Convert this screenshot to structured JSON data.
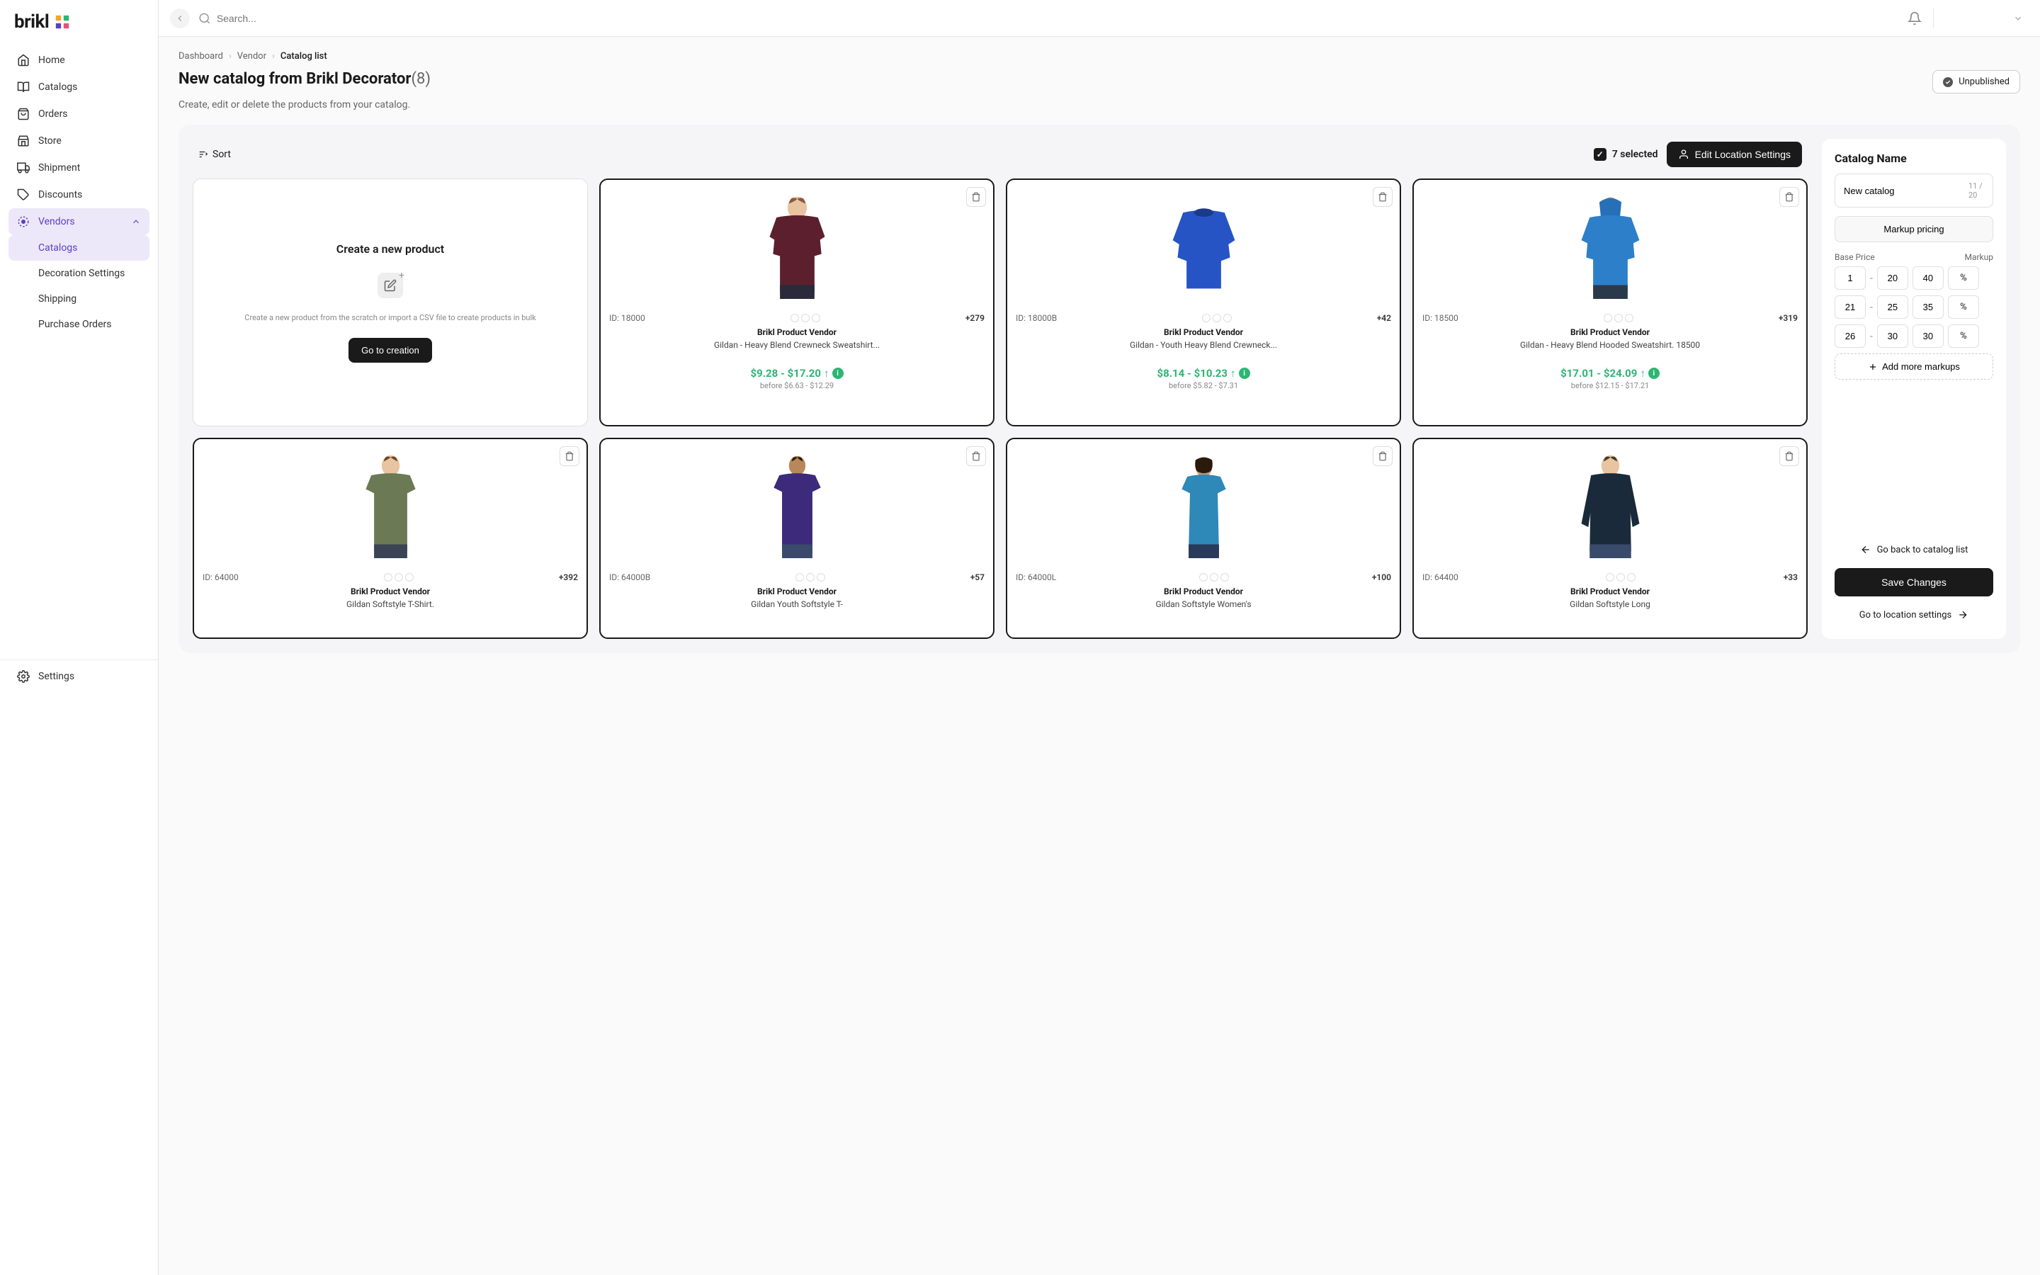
{
  "brand": "brikl",
  "search_placeholder": "Search...",
  "sidebar": {
    "items": [
      {
        "label": "Home",
        "icon": "home"
      },
      {
        "label": "Catalogs",
        "icon": "book"
      },
      {
        "label": "Orders",
        "icon": "bag"
      },
      {
        "label": "Store",
        "icon": "store"
      },
      {
        "label": "Shipment",
        "icon": "truck"
      },
      {
        "label": "Discounts",
        "icon": "tag"
      },
      {
        "label": "Vendors",
        "icon": "target",
        "active": true,
        "expanded": true
      }
    ],
    "sub_items": [
      {
        "label": "Catalogs",
        "active": true
      },
      {
        "label": "Decoration Settings"
      },
      {
        "label": "Shipping"
      },
      {
        "label": "Purchase Orders"
      }
    ],
    "settings_label": "Settings"
  },
  "breadcrumb": [
    "Dashboard",
    "Vendor",
    "Catalog list"
  ],
  "page": {
    "title": "New catalog from Brikl Decorator",
    "count": "(8)",
    "desc": "Create, edit or delete the products from your catalog.",
    "status": "Unpublished"
  },
  "toolbar": {
    "sort": "Sort",
    "selected": "7 selected",
    "edit_location": "Edit Location Settings"
  },
  "create_card": {
    "title": "Create a new product",
    "desc": "Create a new product from the scratch or import a CSV file to create products in bulk",
    "btn": "Go to creation"
  },
  "products": [
    {
      "id": "ID: 18000",
      "variants": "+279",
      "vendor": "Brikl Product Vendor",
      "name": "Gildan - Heavy Blend Crewneck Sweatshirt...",
      "price": "$9.28 - $17.20",
      "before": "before $6.63 - $12.29",
      "selected": true
    },
    {
      "id": "ID: 18000B",
      "variants": "+42",
      "vendor": "Brikl Product Vendor",
      "name": "Gildan - Youth Heavy Blend Crewneck...",
      "price": "$8.14 - $10.23",
      "before": "before $5.82 - $7.31",
      "selected": true
    },
    {
      "id": "ID: 18500",
      "variants": "+319",
      "vendor": "Brikl Product Vendor",
      "name": "Gildan - Heavy Blend Hooded Sweatshirt. 18500",
      "price": "$17.01 - $24.09",
      "before": "before $12.15 - $17.21",
      "selected": true
    },
    {
      "id": "ID: 64000",
      "variants": "+392",
      "vendor": "Brikl Product Vendor",
      "name": "Gildan Softstyle T-Shirt.",
      "selected": true
    },
    {
      "id": "ID: 64000B",
      "variants": "+57",
      "vendor": "Brikl Product Vendor",
      "name": "Gildan Youth Softstyle T-",
      "selected": true
    },
    {
      "id": "ID: 64000L",
      "variants": "+100",
      "vendor": "Brikl Product Vendor",
      "name": "Gildan Softstyle Women's",
      "selected": true
    },
    {
      "id": "ID: 64400",
      "variants": "+33",
      "vendor": "Brikl Product Vendor",
      "name": "Gildan Softstyle Long",
      "selected": true
    }
  ],
  "panel": {
    "title": "Catalog Name",
    "name_value": "New catalog",
    "char_count": "11 / 20",
    "markup_pricing": "Markup pricing",
    "base_price_label": "Base Price",
    "markup_label": "Markup",
    "rows": [
      {
        "from": "1",
        "to": "20",
        "markup": "40"
      },
      {
        "from": "21",
        "to": "25",
        "markup": "35"
      },
      {
        "from": "26",
        "to": "30",
        "markup": "30"
      }
    ],
    "add_more": "Add more markups",
    "back_link": "Go back to catalog list",
    "save": "Save Changes",
    "goto_location": "Go to location settings",
    "percent": "%"
  }
}
